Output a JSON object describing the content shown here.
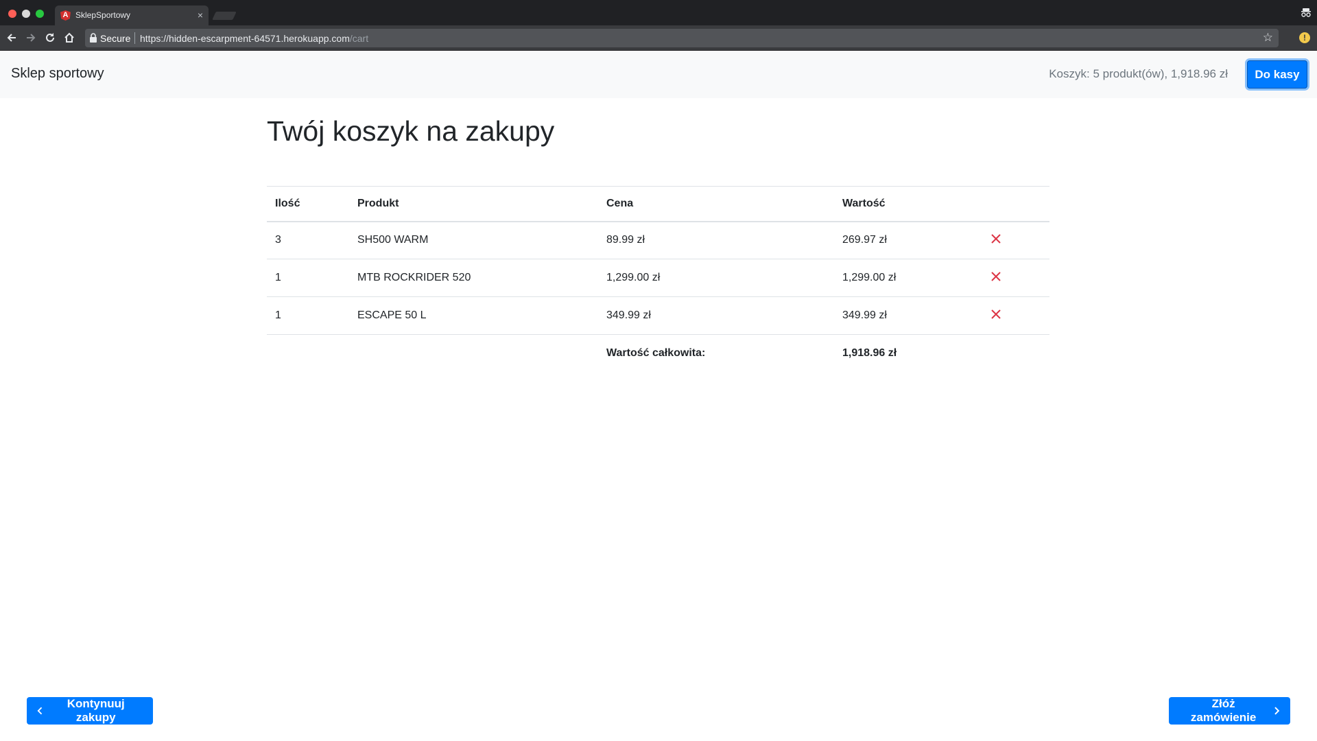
{
  "browser": {
    "tab_title": "SklepSportowy",
    "tab_close": "×",
    "favicon_letter": "A",
    "secure_label": "Secure",
    "url_scheme": "https://",
    "url_host": "hidden-escarpment-64571.herokuapp.com",
    "url_path": "/cart",
    "star": "☆",
    "alert": "!"
  },
  "navbar": {
    "brand": "Sklep sportowy",
    "cart_summary": "Koszyk: 5 produkt(ów), 1,918.96 zł",
    "checkout_label": "Do kasy"
  },
  "main": {
    "title": "Twój koszyk na zakupy"
  },
  "table": {
    "headers": [
      "Ilość",
      "Produkt",
      "Cena",
      "Wartość"
    ],
    "rows": [
      {
        "qty": "3",
        "product": "SH500 WARM",
        "price": "89.99 zł",
        "value": "269.97 zł"
      },
      {
        "qty": "1",
        "product": "MTB ROCKRIDER 520",
        "price": "1,299.00 zł",
        "value": "1,299.00 zł"
      },
      {
        "qty": "1",
        "product": "ESCAPE 50 L",
        "price": "349.99 zł",
        "value": "349.99 zł"
      }
    ],
    "total_label": "Wartość całkowita:",
    "total_value": "1,918.96 zł"
  },
  "actions": {
    "continue_label": "Kontynuuj zakupy",
    "order_label": "Złóż zamówienie"
  },
  "colors": {
    "primary": "#007bff",
    "remove": "#dc3545",
    "navbar_bg": "#f8f9fa"
  }
}
